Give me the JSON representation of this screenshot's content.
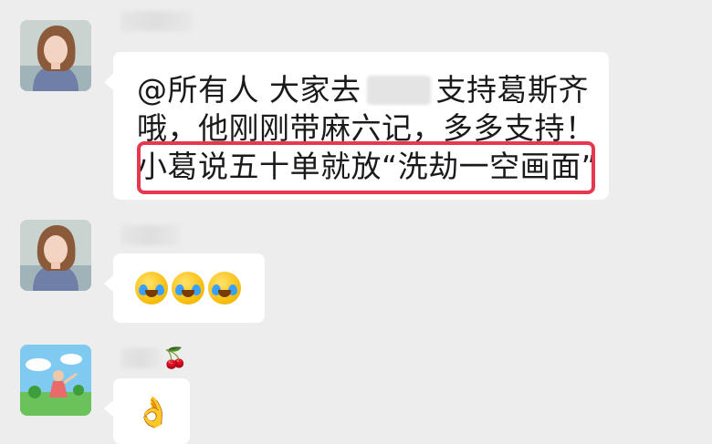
{
  "messages": [
    {
      "id": "msg1",
      "avatar": "woman-portrait-avatar",
      "lines": [
        {
          "pre": "@所有人  大家去",
          "redacted": true,
          "post": "支持葛斯齐"
        },
        {
          "text": "哦，他刚刚带麻六记，多多支持！"
        },
        {
          "text": "小葛说五十单就放“洗劫一空画面”"
        }
      ]
    },
    {
      "id": "msg2",
      "avatar": "woman-portrait-avatar",
      "emojis": [
        "crying-laughing-emoji",
        "crying-laughing-emoji",
        "crying-laughing-emoji"
      ]
    },
    {
      "id": "msg3",
      "avatar": "cartoon-landscape-avatar",
      "name_suffix": "🍒",
      "text": "👌"
    }
  ],
  "colors": {
    "background": "#ededed",
    "bubble": "#ffffff",
    "highlight_border": "#e8384f"
  }
}
